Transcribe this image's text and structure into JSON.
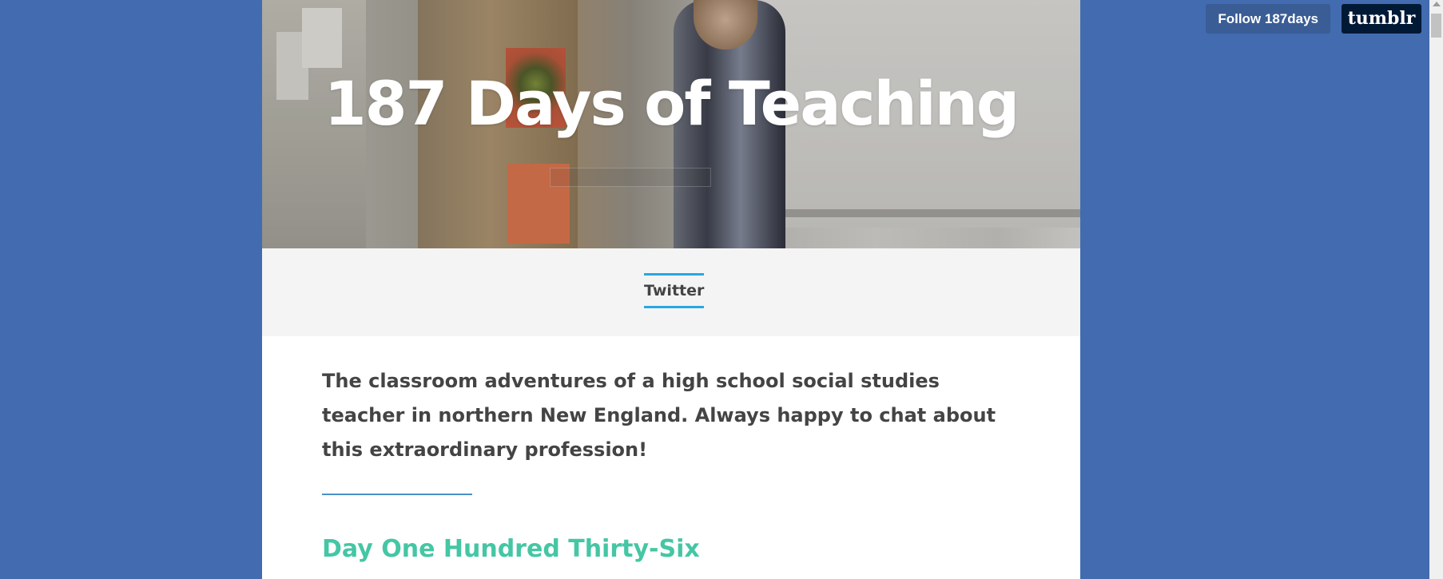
{
  "blog": {
    "title": "187 Days of Teaching",
    "description": "The classroom adventures of a high school social studies teacher in northern New England. Always happy to chat about this extraordinary profession!"
  },
  "nav": {
    "links": [
      {
        "label": "Twitter"
      }
    ]
  },
  "post": {
    "title": "Day One Hundred Thirty-Six"
  },
  "tumblr_controls": {
    "follow_label": "Follow 187days",
    "logo_label": "tumblr"
  },
  "colors": {
    "page_background": "#426bb0",
    "nav_accent": "#2aa7e0",
    "post_title": "#45c6a4",
    "divider": "#4a90c8"
  }
}
